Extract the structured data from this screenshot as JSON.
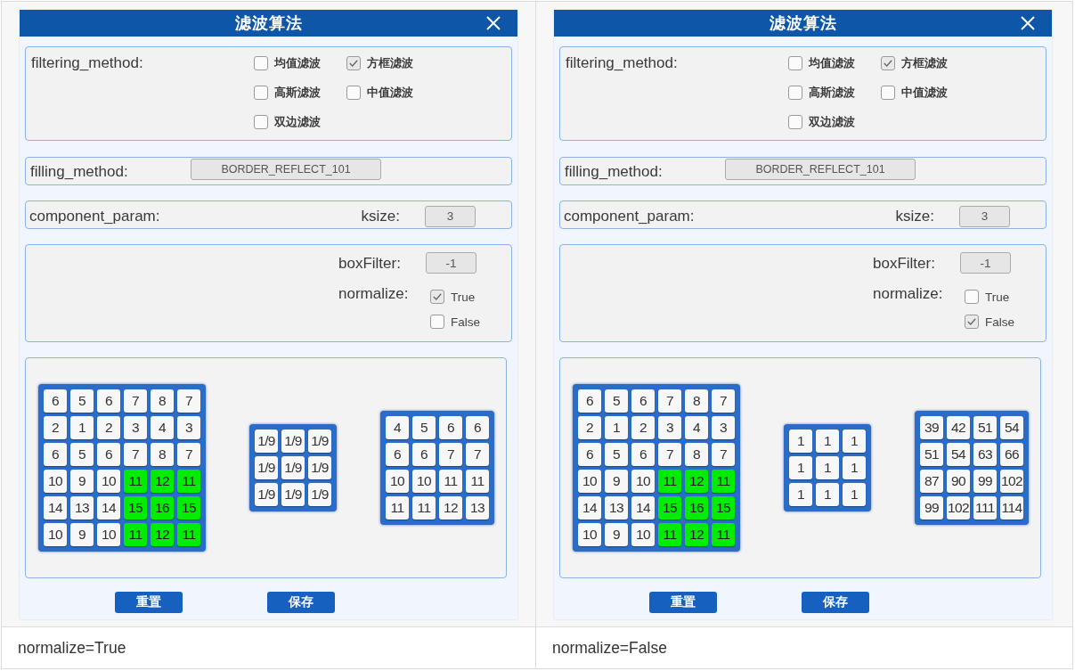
{
  "panels": [
    {
      "dialog": {
        "title": "滤波算法",
        "filtering_method": {
          "label": "filtering_method:",
          "options": [
            {
              "label": "均值滤波",
              "checked": false
            },
            {
              "label": "方框滤波",
              "checked": true
            },
            {
              "label": "高斯滤波",
              "checked": false
            },
            {
              "label": "中值滤波",
              "checked": false
            },
            {
              "label": "双边滤波",
              "checked": false
            }
          ]
        },
        "filling_method": {
          "label": "filling_method:",
          "value": "BORDER_REFLECT_101"
        },
        "component_param": {
          "label": "component_param:",
          "ksize_label": "ksize:",
          "ksize_value": "3"
        },
        "box_filter": {
          "label": "boxFilter:",
          "value": "-1",
          "normalize_label": "normalize:",
          "normalize_options": [
            {
              "label": "True",
              "checked": true
            },
            {
              "label": "False",
              "checked": false
            }
          ]
        },
        "matrices": [
          {
            "rows": [
              [
                {
                  "value": "6",
                  "highlighted": false
                },
                {
                  "value": "5",
                  "highlighted": false
                },
                {
                  "value": "6",
                  "highlighted": false
                },
                {
                  "value": "7",
                  "highlighted": false
                },
                {
                  "value": "8",
                  "highlighted": false
                },
                {
                  "value": "7",
                  "highlighted": false
                }
              ],
              [
                {
                  "value": "2",
                  "highlighted": false
                },
                {
                  "value": "1",
                  "highlighted": false
                },
                {
                  "value": "2",
                  "highlighted": false
                },
                {
                  "value": "3",
                  "highlighted": false
                },
                {
                  "value": "4",
                  "highlighted": false
                },
                {
                  "value": "3",
                  "highlighted": false
                }
              ],
              [
                {
                  "value": "6",
                  "highlighted": false
                },
                {
                  "value": "5",
                  "highlighted": false
                },
                {
                  "value": "6",
                  "highlighted": false
                },
                {
                  "value": "7",
                  "highlighted": false
                },
                {
                  "value": "8",
                  "highlighted": false
                },
                {
                  "value": "7",
                  "highlighted": false
                }
              ],
              [
                {
                  "value": "10",
                  "highlighted": false
                },
                {
                  "value": "9",
                  "highlighted": false
                },
                {
                  "value": "10",
                  "highlighted": false
                },
                {
                  "value": "11",
                  "highlighted": true
                },
                {
                  "value": "12",
                  "highlighted": true
                },
                {
                  "value": "11",
                  "highlighted": true
                }
              ],
              [
                {
                  "value": "14",
                  "highlighted": false
                },
                {
                  "value": "13",
                  "highlighted": false
                },
                {
                  "value": "14",
                  "highlighted": false
                },
                {
                  "value": "15",
                  "highlighted": true
                },
                {
                  "value": "16",
                  "highlighted": true
                },
                {
                  "value": "15",
                  "highlighted": true
                }
              ],
              [
                {
                  "value": "10",
                  "highlighted": false
                },
                {
                  "value": "9",
                  "highlighted": false
                },
                {
                  "value": "10",
                  "highlighted": false
                },
                {
                  "value": "11",
                  "highlighted": true
                },
                {
                  "value": "12",
                  "highlighted": true
                },
                {
                  "value": "11",
                  "highlighted": true
                }
              ]
            ]
          },
          {
            "rows": [
              [
                {
                  "value": "1/9",
                  "highlighted": false
                },
                {
                  "value": "1/9",
                  "highlighted": false
                },
                {
                  "value": "1/9",
                  "highlighted": false
                }
              ],
              [
                {
                  "value": "1/9",
                  "highlighted": false
                },
                {
                  "value": "1/9",
                  "highlighted": false
                },
                {
                  "value": "1/9",
                  "highlighted": false
                }
              ],
              [
                {
                  "value": "1/9",
                  "highlighted": false
                },
                {
                  "value": "1/9",
                  "highlighted": false
                },
                {
                  "value": "1/9",
                  "highlighted": false
                }
              ]
            ]
          },
          {
            "rows": [
              [
                {
                  "value": "4",
                  "highlighted": false
                },
                {
                  "value": "5",
                  "highlighted": false
                },
                {
                  "value": "6",
                  "highlighted": false
                },
                {
                  "value": "6",
                  "highlighted": false
                }
              ],
              [
                {
                  "value": "6",
                  "highlighted": false
                },
                {
                  "value": "6",
                  "highlighted": false
                },
                {
                  "value": "7",
                  "highlighted": false
                },
                {
                  "value": "7",
                  "highlighted": false
                }
              ],
              [
                {
                  "value": "10",
                  "highlighted": false
                },
                {
                  "value": "10",
                  "highlighted": false
                },
                {
                  "value": "11",
                  "highlighted": false
                },
                {
                  "value": "11",
                  "highlighted": false
                }
              ],
              [
                {
                  "value": "11",
                  "highlighted": false
                },
                {
                  "value": "11",
                  "highlighted": false
                },
                {
                  "value": "12",
                  "highlighted": false
                },
                {
                  "value": "13",
                  "highlighted": false
                }
              ]
            ]
          }
        ],
        "buttons": [
          "重置",
          "保存"
        ]
      },
      "caption": "normalize=True"
    },
    {
      "dialog": {
        "title": "滤波算法",
        "filtering_method": {
          "label": "filtering_method:",
          "options": [
            {
              "label": "均值滤波",
              "checked": false
            },
            {
              "label": "方框滤波",
              "checked": true
            },
            {
              "label": "高斯滤波",
              "checked": false
            },
            {
              "label": "中值滤波",
              "checked": false
            },
            {
              "label": "双边滤波",
              "checked": false
            }
          ]
        },
        "filling_method": {
          "label": "filling_method:",
          "value": "BORDER_REFLECT_101"
        },
        "component_param": {
          "label": "component_param:",
          "ksize_label": "ksize:",
          "ksize_value": "3"
        },
        "box_filter": {
          "label": "boxFilter:",
          "value": "-1",
          "normalize_label": "normalize:",
          "normalize_options": [
            {
              "label": "True",
              "checked": false
            },
            {
              "label": "False",
              "checked": true
            }
          ]
        },
        "matrices": [
          {
            "rows": [
              [
                {
                  "value": "6",
                  "highlighted": false
                },
                {
                  "value": "5",
                  "highlighted": false
                },
                {
                  "value": "6",
                  "highlighted": false
                },
                {
                  "value": "7",
                  "highlighted": false
                },
                {
                  "value": "8",
                  "highlighted": false
                },
                {
                  "value": "7",
                  "highlighted": false
                }
              ],
              [
                {
                  "value": "2",
                  "highlighted": false
                },
                {
                  "value": "1",
                  "highlighted": false
                },
                {
                  "value": "2",
                  "highlighted": false
                },
                {
                  "value": "3",
                  "highlighted": false
                },
                {
                  "value": "4",
                  "highlighted": false
                },
                {
                  "value": "3",
                  "highlighted": false
                }
              ],
              [
                {
                  "value": "6",
                  "highlighted": false
                },
                {
                  "value": "5",
                  "highlighted": false
                },
                {
                  "value": "6",
                  "highlighted": false
                },
                {
                  "value": "7",
                  "highlighted": false
                },
                {
                  "value": "8",
                  "highlighted": false
                },
                {
                  "value": "7",
                  "highlighted": false
                }
              ],
              [
                {
                  "value": "10",
                  "highlighted": false
                },
                {
                  "value": "9",
                  "highlighted": false
                },
                {
                  "value": "10",
                  "highlighted": false
                },
                {
                  "value": "11",
                  "highlighted": true
                },
                {
                  "value": "12",
                  "highlighted": true
                },
                {
                  "value": "11",
                  "highlighted": true
                }
              ],
              [
                {
                  "value": "14",
                  "highlighted": false
                },
                {
                  "value": "13",
                  "highlighted": false
                },
                {
                  "value": "14",
                  "highlighted": false
                },
                {
                  "value": "15",
                  "highlighted": true
                },
                {
                  "value": "16",
                  "highlighted": true
                },
                {
                  "value": "15",
                  "highlighted": true
                }
              ],
              [
                {
                  "value": "10",
                  "highlighted": false
                },
                {
                  "value": "9",
                  "highlighted": false
                },
                {
                  "value": "10",
                  "highlighted": false
                },
                {
                  "value": "11",
                  "highlighted": true
                },
                {
                  "value": "12",
                  "highlighted": true
                },
                {
                  "value": "11",
                  "highlighted": true
                }
              ]
            ]
          },
          {
            "rows": [
              [
                {
                  "value": "1",
                  "highlighted": false
                },
                {
                  "value": "1",
                  "highlighted": false
                },
                {
                  "value": "1",
                  "highlighted": false
                }
              ],
              [
                {
                  "value": "1",
                  "highlighted": false
                },
                {
                  "value": "1",
                  "highlighted": false
                },
                {
                  "value": "1",
                  "highlighted": false
                }
              ],
              [
                {
                  "value": "1",
                  "highlighted": false
                },
                {
                  "value": "1",
                  "highlighted": false
                },
                {
                  "value": "1",
                  "highlighted": false
                }
              ]
            ]
          },
          {
            "rows": [
              [
                {
                  "value": "39",
                  "highlighted": false
                },
                {
                  "value": "42",
                  "highlighted": false
                },
                {
                  "value": "51",
                  "highlighted": false
                },
                {
                  "value": "54",
                  "highlighted": false
                }
              ],
              [
                {
                  "value": "51",
                  "highlighted": false
                },
                {
                  "value": "54",
                  "highlighted": false
                },
                {
                  "value": "63",
                  "highlighted": false
                },
                {
                  "value": "66",
                  "highlighted": false
                }
              ],
              [
                {
                  "value": "87",
                  "highlighted": false
                },
                {
                  "value": "90",
                  "highlighted": false
                },
                {
                  "value": "99",
                  "highlighted": false
                },
                {
                  "value": "102",
                  "highlighted": false
                }
              ],
              [
                {
                  "value": "99",
                  "highlighted": false
                },
                {
                  "value": "102",
                  "highlighted": false
                },
                {
                  "value": "111",
                  "highlighted": false
                },
                {
                  "value": "114",
                  "highlighted": false
                }
              ]
            ]
          }
        ],
        "buttons": [
          "重置",
          "保存"
        ]
      },
      "caption": "normalize=False"
    }
  ]
}
